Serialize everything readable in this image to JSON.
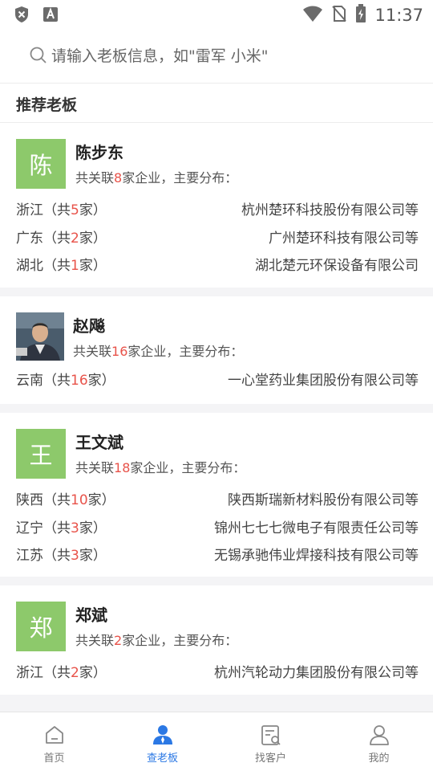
{
  "status_bar": {
    "time": "11:37"
  },
  "search": {
    "placeholder": "请输入老板信息，如\"雷军 小米\""
  },
  "section_title": "推荐老板",
  "bosses": [
    {
      "avatar_char": "陈",
      "name": "陈步东",
      "summary_prefix": "共关联",
      "count": "8",
      "summary_suffix": "家企业，主要分布：",
      "regions": [
        {
          "province": "浙江",
          "open": "（共",
          "count": "5",
          "close": "家）",
          "company": "杭州楚环科技股份有限公司等"
        },
        {
          "province": "广东",
          "open": "（共",
          "count": "2",
          "close": "家）",
          "company": "广州楚环科技有限公司等"
        },
        {
          "province": "湖北",
          "open": "（共",
          "count": "1",
          "close": "家）",
          "company": "湖北楚元环保设备有限公司"
        }
      ]
    },
    {
      "avatar_char": "",
      "name": "赵飚",
      "summary_prefix": "共关联",
      "count": "16",
      "summary_suffix": "家企业，主要分布：",
      "regions": [
        {
          "province": "云南",
          "open": "（共",
          "count": "16",
          "close": "家）",
          "company": "一心堂药业集团股份有限公司等"
        }
      ]
    },
    {
      "avatar_char": "王",
      "name": "王文斌",
      "summary_prefix": "共关联",
      "count": "18",
      "summary_suffix": "家企业，主要分布：",
      "regions": [
        {
          "province": "陕西",
          "open": "（共",
          "count": "10",
          "close": "家）",
          "company": "陕西斯瑞新材料股份有限公司等"
        },
        {
          "province": "辽宁",
          "open": "（共",
          "count": "3",
          "close": "家）",
          "company": "锦州七七七微电子有限责任公司等"
        },
        {
          "province": "江苏",
          "open": "（共",
          "count": "3",
          "close": "家）",
          "company": "无锡承驰伟业焊接科技有限公司等"
        }
      ]
    },
    {
      "avatar_char": "郑",
      "name": "郑斌",
      "summary_prefix": "共关联",
      "count": "2",
      "summary_suffix": "家企业，主要分布：",
      "regions": [
        {
          "province": "浙江",
          "open": "（共",
          "count": "2",
          "close": "家）",
          "company": "杭州汽轮动力集团股份有限公司等"
        }
      ]
    }
  ],
  "tabs": [
    {
      "label": "首页",
      "icon": "home-icon"
    },
    {
      "label": "查老板",
      "icon": "boss-icon"
    },
    {
      "label": "找客户",
      "icon": "customer-search-icon"
    },
    {
      "label": "我的",
      "icon": "profile-icon"
    }
  ],
  "colors": {
    "accent": "#2b78e4",
    "avatar_bg": "#8dc96b",
    "count_highlight": "#e8534a"
  }
}
